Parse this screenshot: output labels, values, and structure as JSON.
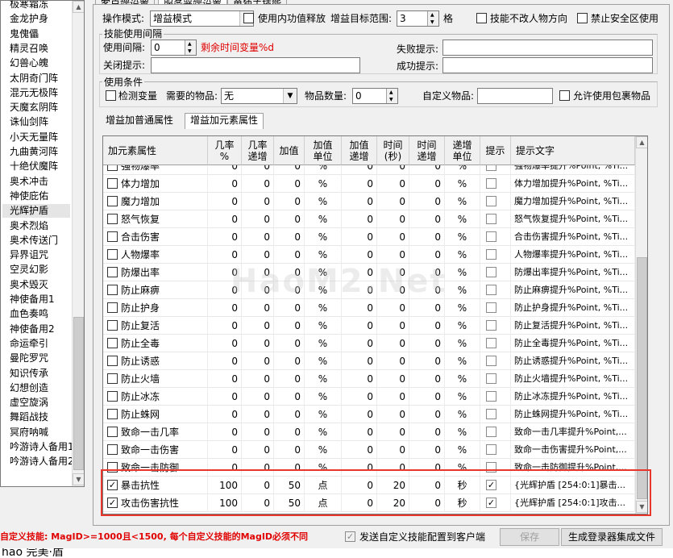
{
  "skill_list": {
    "items": [
      "极寒霜冻",
      "金龙护身",
      "鬼傀儡",
      "精灵召唤",
      "幻兽心魄",
      "太阴奇门阵",
      "混元无极阵",
      "天魔玄阴阵",
      "诛仙剑阵",
      "小天无量阵",
      "九曲黄河阵",
      "十绝伏魔阵",
      "奥术冲击",
      "神使庇佑",
      "光辉护盾",
      "奥术烈焰",
      "奥术传送门",
      "异界诅咒",
      "空灵幻影",
      "奥术毁灭",
      "神使备用1",
      "血色奏鸣",
      "神使备用2",
      "命运牵引",
      "曼陀罗咒",
      "知识传承",
      "幻想创造",
      "虚空旋涡",
      "舞蹈战技",
      "冥府呐喊",
      "吟游诗人备用1",
      "吟游诗人备用2"
    ],
    "selected": "光辉护盾"
  },
  "tabs": [
    "客户端设置",
    "服务器端设置",
    "单独主技能"
  ],
  "tabs_visible": [
    "客户端设置",
    "服务器端设置",
    "单独主技能"
  ],
  "top": {
    "mode_label": "操作模式:",
    "mode_value": "增益模式",
    "use_internal_label": "使用内功值释放",
    "target_range_label": "增益目标范围:",
    "target_range_value": "3",
    "target_range_unit": "格",
    "no_face_label": "技能不改人物方向",
    "no_safe_zone_label": "禁止安全区使用"
  },
  "interval_group": {
    "title": "技能使用间隔",
    "interval_label": "使用间隔:",
    "interval_value": "0",
    "remaining_var": "剩余时间变量%d",
    "fail_label": "失败提示:",
    "close_label": "关闭提示:",
    "success_label": "成功提示:"
  },
  "condition_group": {
    "title": "使用条件",
    "detect_var_label": "检测变量",
    "item_needed_label": "需要的物品:",
    "item_needed_value": "无",
    "item_count_label": "物品数量:",
    "item_count_value": "0",
    "custom_item_label": "自定义物品:",
    "allow_bag_label": "允许使用包裹物品"
  },
  "subtabs": [
    "增益加普通属性",
    "增益加元素属性"
  ],
  "grid": {
    "headers": [
      "加元素属性",
      "几率\n%",
      "几率\n递增",
      "加值",
      "加值\n单位",
      "加值\n递增",
      "时间\n(秒)",
      "时间\n递增",
      "递增\n单位",
      "提示",
      "提示文字"
    ],
    "rows": [
      {
        "checked": false,
        "name": "强物爆率",
        "v": [
          "0",
          "0",
          "0",
          "%",
          "0",
          "0",
          "0",
          "%"
        ],
        "tip_checked": false,
        "tip": "强物爆率提升%Point, %Ti..."
      },
      {
        "checked": false,
        "name": "体力增加",
        "v": [
          "0",
          "0",
          "0",
          "%",
          "0",
          "0",
          "0",
          "%"
        ],
        "tip_checked": false,
        "tip": "体力增加提升%Point, %Ti..."
      },
      {
        "checked": false,
        "name": "魔力增加",
        "v": [
          "0",
          "0",
          "0",
          "%",
          "0",
          "0",
          "0",
          "%"
        ],
        "tip_checked": false,
        "tip": "魔力增加提升%Point, %Ti..."
      },
      {
        "checked": false,
        "name": "怒气恢复",
        "v": [
          "0",
          "0",
          "0",
          "%",
          "0",
          "0",
          "0",
          "%"
        ],
        "tip_checked": false,
        "tip": "怒气恢复提升%Point, %Ti..."
      },
      {
        "checked": false,
        "name": "合击伤害",
        "v": [
          "0",
          "0",
          "0",
          "%",
          "0",
          "0",
          "0",
          "%"
        ],
        "tip_checked": false,
        "tip": "合击伤害提升%Point, %Ti..."
      },
      {
        "checked": false,
        "name": "人物爆率",
        "v": [
          "0",
          "0",
          "0",
          "%",
          "0",
          "0",
          "0",
          "%"
        ],
        "tip_checked": false,
        "tip": "人物爆率提升%Point, %Ti..."
      },
      {
        "checked": false,
        "name": "防爆出率",
        "v": [
          "0",
          "0",
          "0",
          "%",
          "0",
          "0",
          "0",
          "%"
        ],
        "tip_checked": false,
        "tip": "防爆出率提升%Point, %Ti..."
      },
      {
        "checked": false,
        "name": "防止麻痹",
        "v": [
          "0",
          "0",
          "0",
          "%",
          "0",
          "0",
          "0",
          "%"
        ],
        "tip_checked": false,
        "tip": "防止麻痹提升%Point, %Ti..."
      },
      {
        "checked": false,
        "name": "防止护身",
        "v": [
          "0",
          "0",
          "0",
          "%",
          "0",
          "0",
          "0",
          "%"
        ],
        "tip_checked": false,
        "tip": "防止护身提升%Point, %Ti..."
      },
      {
        "checked": false,
        "name": "防止复活",
        "v": [
          "0",
          "0",
          "0",
          "%",
          "0",
          "0",
          "0",
          "%"
        ],
        "tip_checked": false,
        "tip": "防止复活提升%Point, %Ti..."
      },
      {
        "checked": false,
        "name": "防止全毒",
        "v": [
          "0",
          "0",
          "0",
          "%",
          "0",
          "0",
          "0",
          "%"
        ],
        "tip_checked": false,
        "tip": "防止全毒提升%Point, %Ti..."
      },
      {
        "checked": false,
        "name": "防止诱惑",
        "v": [
          "0",
          "0",
          "0",
          "%",
          "0",
          "0",
          "0",
          "%"
        ],
        "tip_checked": false,
        "tip": "防止诱惑提升%Point, %Ti..."
      },
      {
        "checked": false,
        "name": "防止火墙",
        "v": [
          "0",
          "0",
          "0",
          "%",
          "0",
          "0",
          "0",
          "%"
        ],
        "tip_checked": false,
        "tip": "防止火墙提升%Point, %Ti..."
      },
      {
        "checked": false,
        "name": "防止冰冻",
        "v": [
          "0",
          "0",
          "0",
          "%",
          "0",
          "0",
          "0",
          "%"
        ],
        "tip_checked": false,
        "tip": "防止冰冻提升%Point, %Ti..."
      },
      {
        "checked": false,
        "name": "防止蛛网",
        "v": [
          "0",
          "0",
          "0",
          "%",
          "0",
          "0",
          "0",
          "%"
        ],
        "tip_checked": false,
        "tip": "防止蛛网提升%Point, %Ti..."
      },
      {
        "checked": false,
        "name": "致命一击几率",
        "v": [
          "0",
          "0",
          "0",
          "%",
          "0",
          "0",
          "0",
          "%"
        ],
        "tip_checked": false,
        "tip": "致命一击几率提升%Point,..."
      },
      {
        "checked": false,
        "name": "致命一击伤害",
        "v": [
          "0",
          "0",
          "0",
          "%",
          "0",
          "0",
          "0",
          "%"
        ],
        "tip_checked": false,
        "tip": "致命一击伤害提升%Point,..."
      },
      {
        "checked": false,
        "name": "致命一击防御",
        "v": [
          "0",
          "0",
          "0",
          "%",
          "0",
          "0",
          "0",
          "%"
        ],
        "tip_checked": false,
        "tip": "致命一击防御提升%Point,..."
      },
      {
        "checked": true,
        "name": "暴击抗性",
        "v": [
          "100",
          "0",
          "50",
          "点",
          "0",
          "20",
          "0",
          "秒"
        ],
        "tip_checked": true,
        "tip": "{光辉护盾 [254:0:1]暴击..."
      },
      {
        "checked": true,
        "name": "攻击伤害抗性",
        "v": [
          "100",
          "0",
          "50",
          "点",
          "0",
          "20",
          "0",
          "秒"
        ],
        "tip_checked": true,
        "tip": "{光辉护盾 [254:0:1]攻击..."
      }
    ]
  },
  "watermark": "HaoM2.Net",
  "bottom": {
    "custom_skill_note": "自定义技能: MagID>=1000且<1500, 每个自定义技能的MagID必须不同",
    "send_label": "发送自定义技能配置到客户端",
    "save_label": "保存",
    "generate_label": "生成登录器集成文件",
    "cut_text": "hao 完美·盾"
  },
  "colors": {
    "accent_red": "#e8362b",
    "note_red": "#e00000"
  }
}
